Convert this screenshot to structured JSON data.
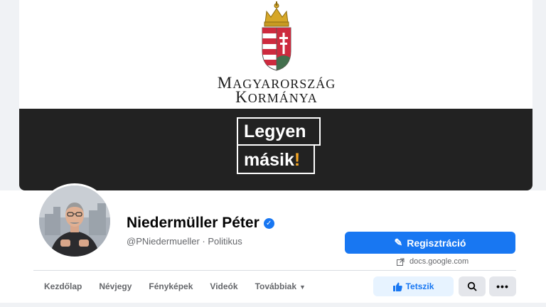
{
  "cover": {
    "gov_line1_first": "M",
    "gov_line1_rest": "AGYARORSZÁG",
    "gov_line2_first": "K",
    "gov_line2_rest": "ORMÁNYA",
    "slogan_line1": "Legyen",
    "slogan_line2_text": "másik",
    "slogan_line2_mark": "!",
    "colors": {
      "banner": "#222222",
      "exclamation": "#f5a623",
      "shield_red": "#cd2a3e",
      "shield_green": "#436f4d"
    }
  },
  "profile": {
    "name": "Niedermüller Péter",
    "handle_line": "@PNiedermueller · Politikus",
    "verified_icon": "verified-badge-icon"
  },
  "actions": {
    "register_label": "Regisztráció",
    "sponsor_domain": "docs.google.com",
    "like_label": "Tetszik",
    "more_label": "•••",
    "accent": "#1877f2"
  },
  "tabs": [
    {
      "label": "Kezdőlap"
    },
    {
      "label": "Névjegy"
    },
    {
      "label": "Fényképek"
    },
    {
      "label": "Videók"
    },
    {
      "label": "Továbbiak",
      "caret": "▼"
    }
  ]
}
